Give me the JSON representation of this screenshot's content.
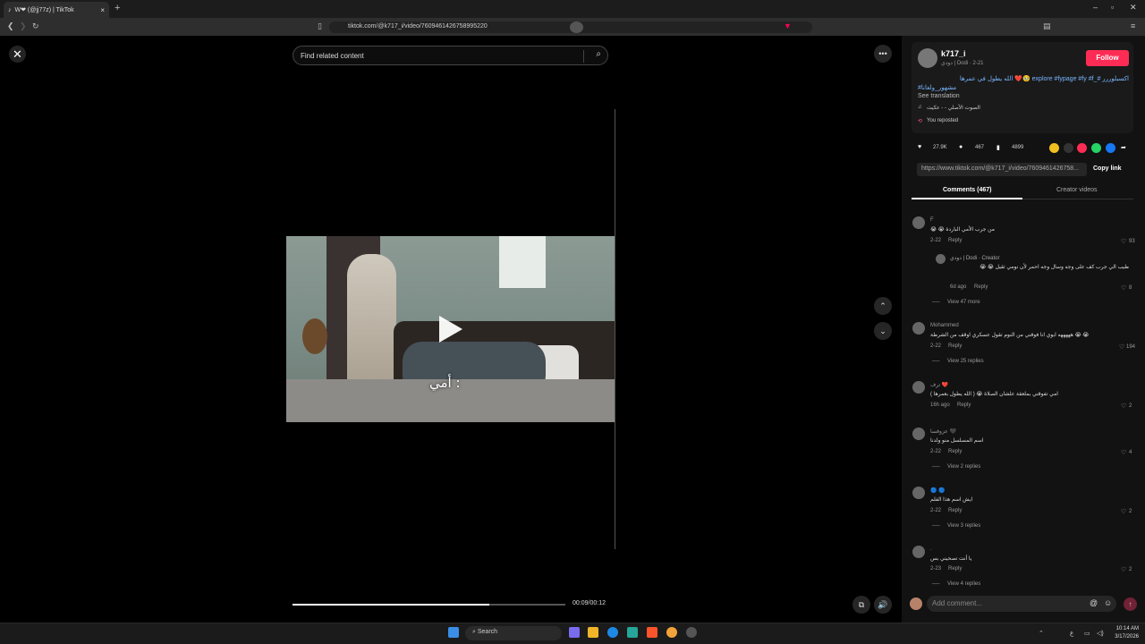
{
  "browser": {
    "tab_title": "W❤ (@jj77z) | TikTok",
    "tab_close": "×",
    "new_tab": "+",
    "url": "tiktok.com/@k717_i/video/7609461426758995220",
    "win_min": "–",
    "win_max": "▫",
    "win_close": "✕"
  },
  "page": {
    "close_glyph": "✕",
    "search_placeholder": "Find related content",
    "subtitle": "أمي :",
    "time": "00:09/00:12",
    "progress": 0.72,
    "more_glyph": "•••"
  },
  "post": {
    "username": "k717_i",
    "byline": "دودي | Dodi · 2-21",
    "follow": "Follow",
    "caption": "اكسبلوررر #_explore #fypage #fy #f 🥹❤️ الله يطول في عمرها",
    "caption_tag2": "#مشهور_ولغانا",
    "see_translation": "See translation",
    "sound": "الصوت الأصلي - - عكيت",
    "reposted": "You reposted",
    "likes": "27.9K",
    "comments": "467",
    "saves": "4899",
    "link": "https://www.tiktok.com/@k717_i/video/7609461426758...",
    "copy_link": "Copy link",
    "tab_comments": "Comments (467)",
    "tab_creator": "Creator videos",
    "add_comment": "Add comment..."
  },
  "comments": [
    {
      "user": "F",
      "text": "😭 😭 من جرب الأمي الباردة",
      "date": "2-22",
      "reply": "Reply",
      "likes": "93"
    },
    {
      "user": "دودي | Dodi · Creator",
      "text": "طيب الي جرب كف على وجه وسال وجه احمر لأن نومي ثقيل 😭 😭",
      "date": "6d ago",
      "reply": "Reply",
      "likes": "8"
    },
    {
      "view": "View 47 more"
    },
    {
      "user": "Mohammed",
      "text": "هههههه ابوي انا فوقني من النوم تقول عسكري اوقف من الشرطة 😭 😭",
      "date": "2-22",
      "reply": "Reply",
      "likes": "194"
    },
    {
      "view": "View 25 replies"
    },
    {
      "user": "ترف ❤️",
      "text": "امي تفوقني بملعقة علشان الصلاة 😭 ( الله يطول بعمرها )",
      "date": "16h ago",
      "reply": "Reply",
      "likes": "2"
    },
    {
      "user": "عزوفسا 🖤",
      "text": "اسم المسلسل منو ولدنا",
      "date": "2-22",
      "reply": "Reply",
      "likes": "4"
    },
    {
      "view": "View 2 replies"
    },
    {
      "user": "🔵 🔵",
      "text": "ايش اسم هذا الفلم",
      "date": "2-22",
      "reply": "Reply",
      "likes": "2"
    },
    {
      "view": "View 3 replies"
    },
    {
      "user": ".",
      "text": "يا أنت تصحيني بس",
      "date": "2-23",
      "reply": "Reply",
      "likes": "2"
    },
    {
      "view": "View 4 replies"
    }
  ],
  "taskbar": {
    "search": "Search",
    "time": "10:14 AM",
    "date": "3/17/2026",
    "lang": "ع"
  }
}
